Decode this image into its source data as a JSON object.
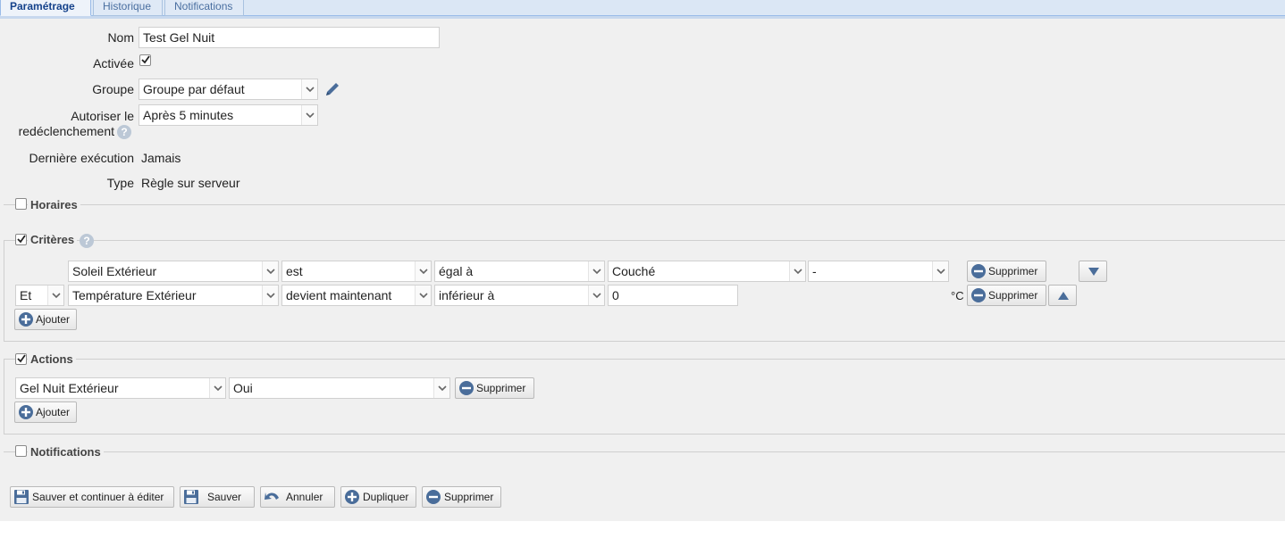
{
  "tabs": [
    {
      "label": "Paramétrage"
    },
    {
      "label": "Historique"
    },
    {
      "label": "Notifications"
    }
  ],
  "form": {
    "name_label": "Nom",
    "name_value": "Test Gel Nuit",
    "active_label": "Activée",
    "group_label": "Groupe",
    "group_value": "Groupe par défaut",
    "retrigger_label_1": "Autoriser le",
    "retrigger_label_2": "redéclenchement",
    "retrigger_value": "Après 5 minutes",
    "last_run_label": "Dernière exécution",
    "last_run_value": "Jamais",
    "type_label": "Type",
    "type_value": "Règle sur serveur"
  },
  "sections": {
    "horaires": "Horaires",
    "criteres": "Critères",
    "actions": "Actions",
    "notifications": "Notifications"
  },
  "criteria": [
    {
      "connector": "",
      "device": "Soleil Extérieur",
      "event": "est",
      "operator": "égal à",
      "value": "Couché",
      "extra": "-",
      "unit": "",
      "delete": "Supprimer"
    },
    {
      "connector": "Et",
      "device": "Température Extérieur",
      "event": "devient maintenant",
      "operator": "inférieur à",
      "value": "0",
      "extra": "",
      "unit": "°C",
      "delete": "Supprimer"
    }
  ],
  "criteria_add": "Ajouter",
  "actions": [
    {
      "device": "Gel Nuit Extérieur",
      "value": "Oui",
      "delete": "Supprimer"
    }
  ],
  "actions_add": "Ajouter",
  "footer": {
    "save_continue": "Sauver et continuer à éditer",
    "save": "Sauver",
    "cancel": "Annuler",
    "duplicate": "Dupliquer",
    "delete": "Supprimer"
  },
  "colors": {
    "tab_active": "#15428b",
    "icon_blue": "#4a6d9a"
  }
}
